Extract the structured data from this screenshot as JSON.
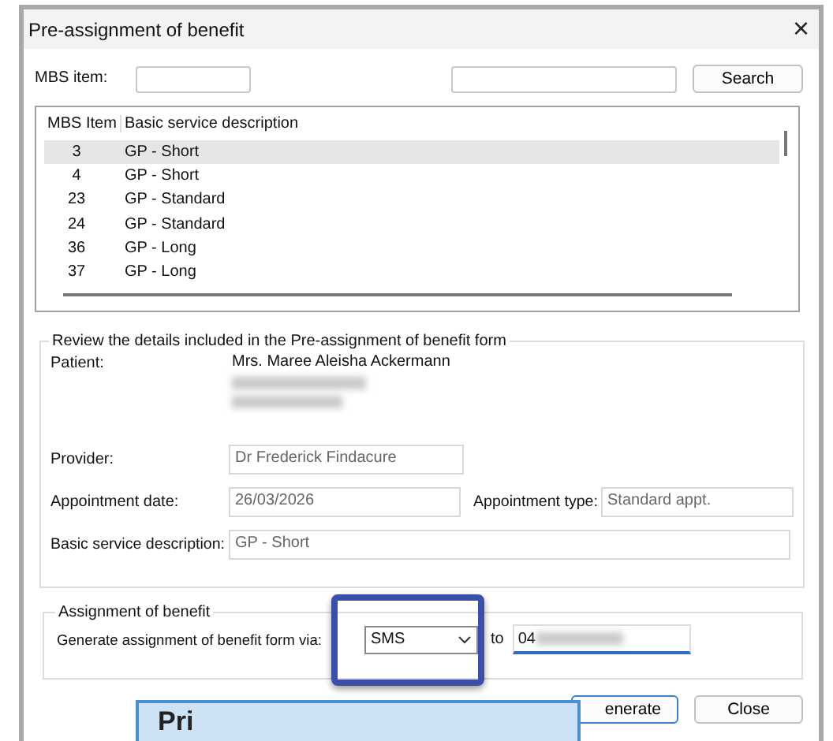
{
  "window": {
    "title": "Pre-assignment of benefit",
    "close": "×"
  },
  "search_bar": {
    "mbs_label": "MBS item:",
    "button": "Search"
  },
  "table": {
    "columns": [
      "MBS Item",
      "Basic service description"
    ],
    "rows": [
      {
        "item": "3",
        "description": "GP - Short",
        "selected": true
      },
      {
        "item": "4",
        "description": "GP - Short",
        "selected": false
      },
      {
        "item": "23",
        "description": "GP - Standard",
        "selected": false
      },
      {
        "item": "24",
        "description": "GP - Standard",
        "selected": false
      },
      {
        "item": "36",
        "description": "GP - Long",
        "selected": false
      },
      {
        "item": "37",
        "description": "GP - Long",
        "selected": false
      }
    ]
  },
  "review": {
    "legend": "Review the details included in the Pre-assignment of benefit form",
    "patient_label": "Patient:",
    "patient_name": "Mrs. Maree Aleisha Ackermann",
    "provider_label": "Provider:",
    "provider": "Dr Frederick Findacure",
    "date_label": "Appointment date:",
    "date": "26/03/2026",
    "type_label": "Appointment type:",
    "type": "Standard appt.",
    "service_label": "Basic service description:",
    "service": "GP - Short"
  },
  "assignment": {
    "legend": "Assignment of benefit",
    "label": "Generate assignment of benefit form via:",
    "method": "SMS",
    "to_label": "to",
    "phone": "04",
    "highlighted": true
  },
  "buttons": {
    "generate": "enerate",
    "close": "Close"
  },
  "popup": {
    "text": "Pri"
  }
}
